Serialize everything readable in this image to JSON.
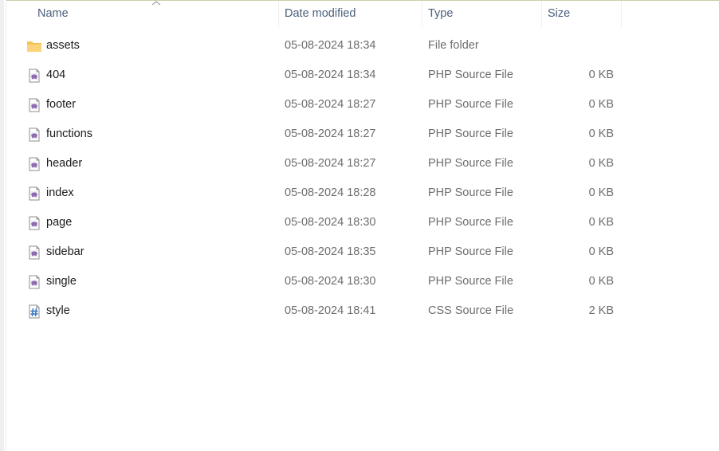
{
  "columns": {
    "name": "Name",
    "date_modified": "Date modified",
    "type": "Type",
    "size": "Size",
    "sort_column": "Name",
    "sort_direction": "ascending"
  },
  "files": [
    {
      "name": "assets",
      "date": "05-08-2024 18:34",
      "type": "File folder",
      "size": "",
      "icon": "folder-icon"
    },
    {
      "name": "404",
      "date": "05-08-2024 18:34",
      "type": "PHP Source File",
      "size": "0 KB",
      "icon": "php-file-icon"
    },
    {
      "name": "footer",
      "date": "05-08-2024 18:27",
      "type": "PHP Source File",
      "size": "0 KB",
      "icon": "php-file-icon"
    },
    {
      "name": "functions",
      "date": "05-08-2024 18:27",
      "type": "PHP Source File",
      "size": "0 KB",
      "icon": "php-file-icon"
    },
    {
      "name": "header",
      "date": "05-08-2024 18:27",
      "type": "PHP Source File",
      "size": "0 KB",
      "icon": "php-file-icon"
    },
    {
      "name": "index",
      "date": "05-08-2024 18:28",
      "type": "PHP Source File",
      "size": "0 KB",
      "icon": "php-file-icon"
    },
    {
      "name": "page",
      "date": "05-08-2024 18:30",
      "type": "PHP Source File",
      "size": "0 KB",
      "icon": "php-file-icon"
    },
    {
      "name": "sidebar",
      "date": "05-08-2024 18:35",
      "type": "PHP Source File",
      "size": "0 KB",
      "icon": "php-file-icon"
    },
    {
      "name": "single",
      "date": "05-08-2024 18:30",
      "type": "PHP Source File",
      "size": "0 KB",
      "icon": "php-file-icon"
    },
    {
      "name": "style",
      "date": "05-08-2024 18:41",
      "type": "CSS Source File",
      "size": "2 KB",
      "icon": "css-file-icon"
    }
  ],
  "colors": {
    "folder": "#f8c655",
    "php": "#8e6bb0",
    "css": "#3d7bc4"
  }
}
